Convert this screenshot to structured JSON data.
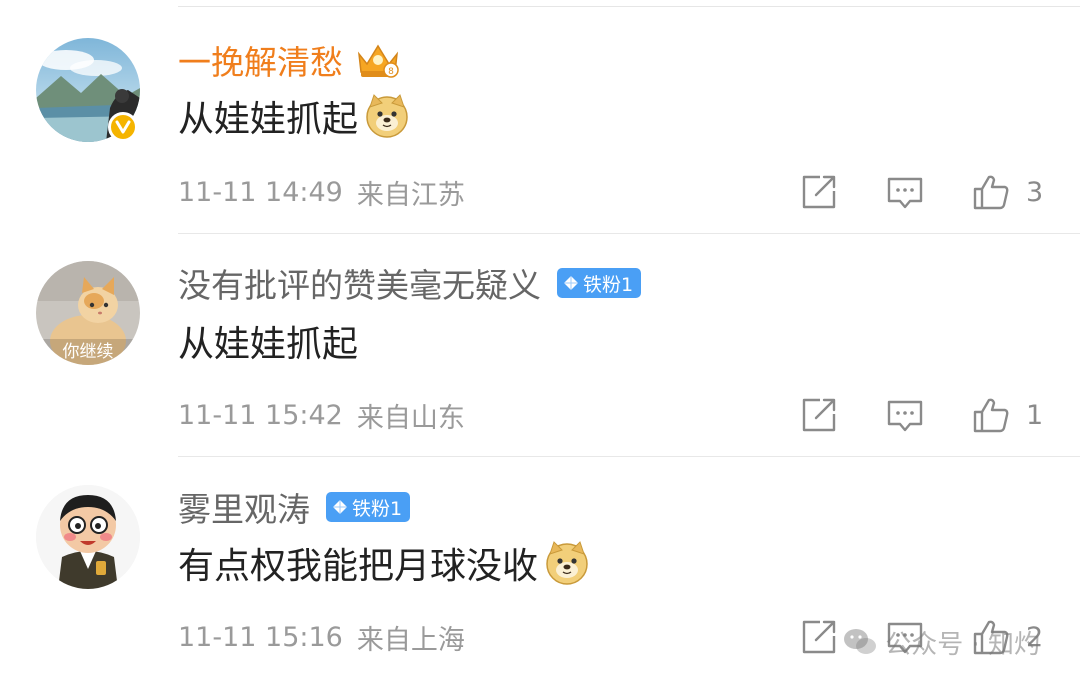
{
  "comments": [
    {
      "user": "一挽解清愁",
      "text": "从娃娃抓起",
      "time": "11-11 14:49",
      "location": "来自江苏",
      "likes": "3"
    },
    {
      "user": "没有批评的赞美毫无疑义",
      "badge": "铁粉1",
      "text": "从娃娃抓起",
      "avatar_caption": "你继续",
      "time": "11-11 15:42",
      "location": "来自山东",
      "likes": "1"
    },
    {
      "user": "雾里观涛",
      "badge": "铁粉1",
      "text": "有点权我能把月球没收",
      "time": "11-11 15:16",
      "location": "来自上海",
      "likes": "2"
    }
  ],
  "watermark": {
    "text": "公众号 · 知灼"
  },
  "colors": {
    "vip_name": "#f07e1c",
    "badge_bg": "#4a9ff5",
    "verified": "#f5b400",
    "meta": "#9a9a9a"
  },
  "icons": [
    "verified-v-icon",
    "crown-icon",
    "diamond-icon",
    "doge-emoji",
    "share-icon",
    "comment-icon",
    "like-icon",
    "wechat-icon"
  ]
}
